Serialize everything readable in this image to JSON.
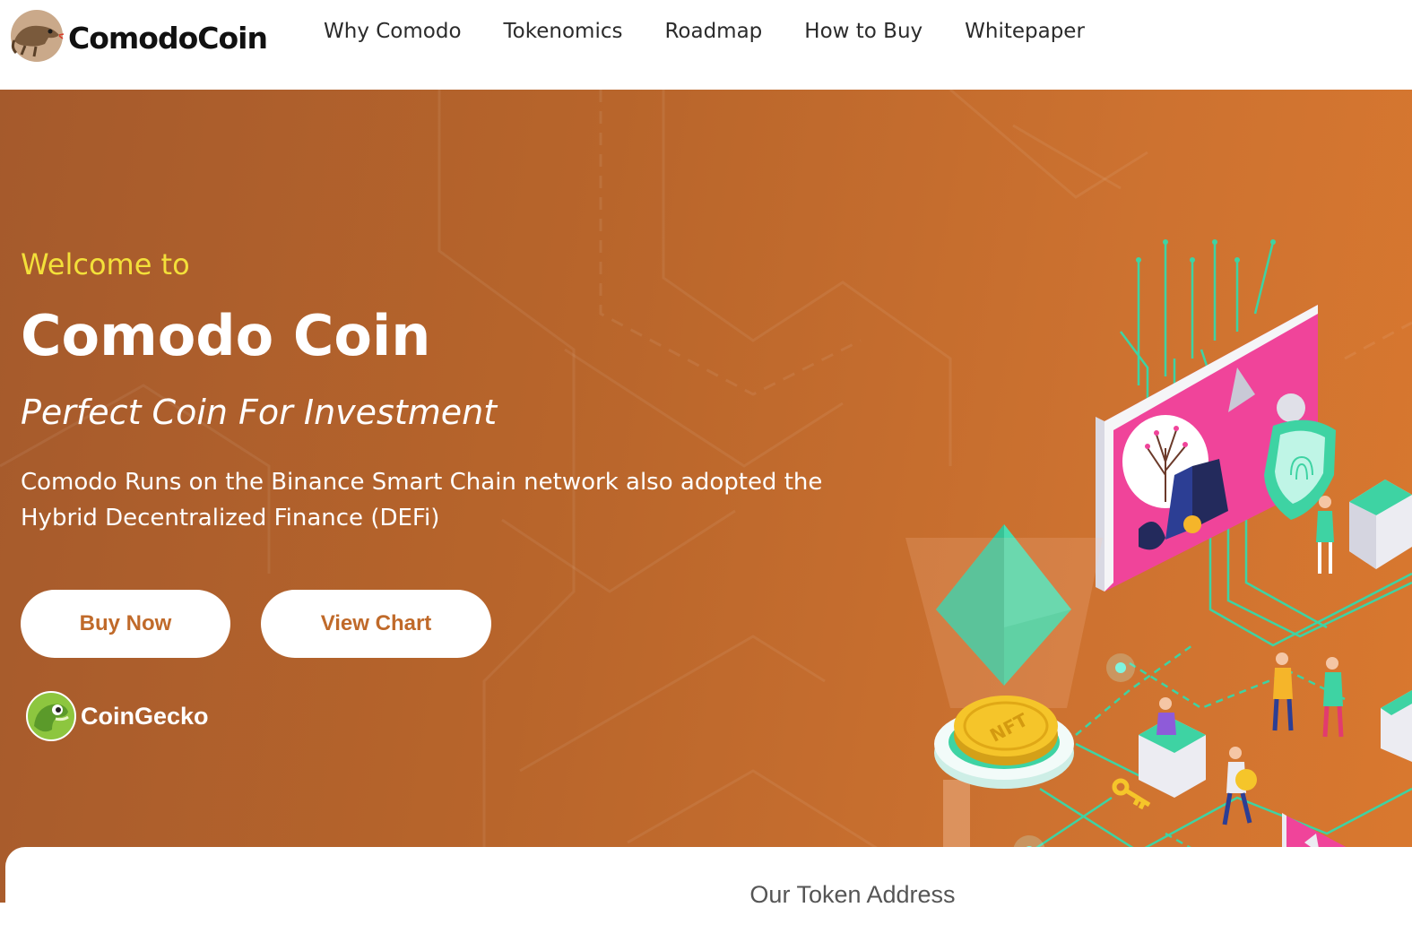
{
  "brand": {
    "name": "ComodoCoin",
    "logo_icon": "komodo-dragon-logo-icon"
  },
  "nav": {
    "items": [
      {
        "label": "Why Comodo"
      },
      {
        "label": "Tokenomics"
      },
      {
        "label": "Roadmap"
      },
      {
        "label": "How to Buy"
      },
      {
        "label": "Whitepaper"
      }
    ]
  },
  "hero": {
    "welcome": "Welcome to",
    "title": "Comodo Coin",
    "subtitle": "Perfect Coin For Investment",
    "description": "Comodo Runs on the Binance Smart Chain network also adopted the Hybrid Decentralized Finance (DEFi)",
    "buy_button": "Buy Now",
    "chart_button": "View Chart",
    "coingecko_label": "CoinGecko",
    "coingecko_icon": "coingecko-gecko-icon",
    "illustration_icon": "nft-isometric-illustration",
    "nft_coin_text": "NFT"
  },
  "token_section": {
    "title": "Our Token Address"
  },
  "colors": {
    "hero_start": "#a55a2c",
    "hero_end": "#d9782f",
    "welcome_yellow": "#f3e03a",
    "button_text": "#c06a2a",
    "teal": "#3ed3a3",
    "pink": "#f0449a"
  }
}
